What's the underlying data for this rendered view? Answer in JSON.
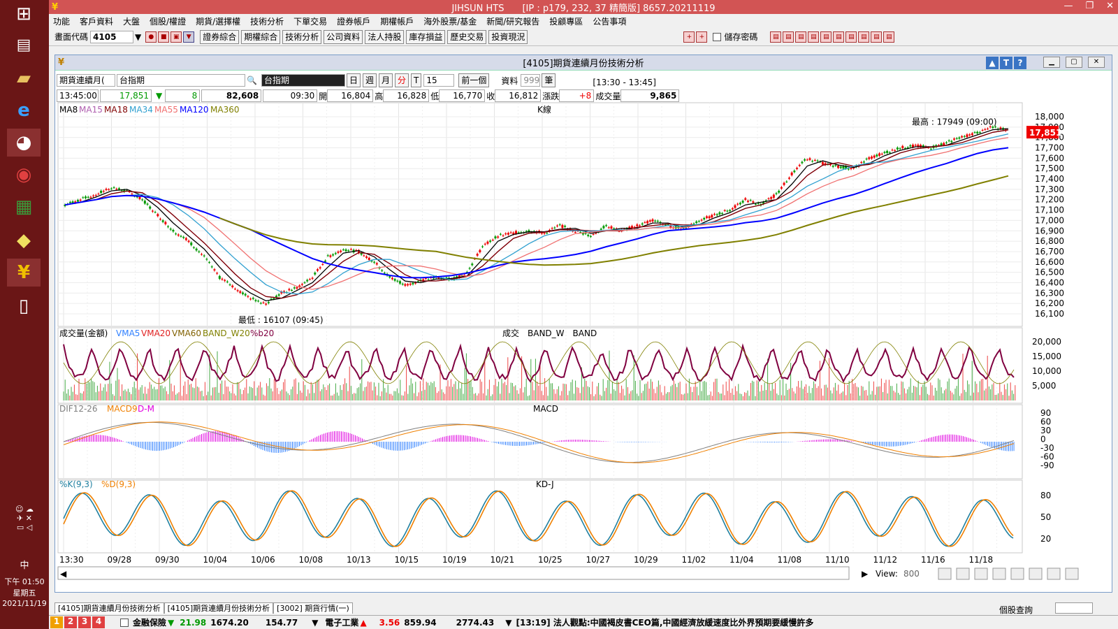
{
  "taskbar": {
    "icons": [
      "windows-icon",
      "window-icon",
      "folder-icon",
      "ie-icon",
      "paint-icon",
      "chrome-icon",
      "excel-icon",
      "sticky-icon",
      "jihsun-icon",
      "file-icon"
    ],
    "time": "下午 01:50",
    "weekday": "星期五",
    "date": "2021/11/19",
    "ime": "中"
  },
  "app": {
    "title": "JIHSUN HTS　　[IP : p179, 232, 37 精簡版] 8657.20211119",
    "menu": [
      "功能",
      "客戶資料",
      "大盤",
      "個股/權證",
      "期貨/選擇權",
      "技術分析",
      "下單交易",
      "證券帳戶",
      "期權帳戶",
      "海外股票/基金",
      "新聞/研究報告",
      "投顧專區",
      "公告事項"
    ],
    "toolbar": {
      "code_label": "畫面代碼",
      "code_value": "4105",
      "buttons": [
        "證券綜合",
        "期權綜合",
        "技術分析",
        "公司資料",
        "法人持股",
        "庫存損益",
        "歷史交易",
        "投資現況"
      ],
      "save_pw": "儲存密碼"
    }
  },
  "window": {
    "title": "[4105]期貨連續月份技術分析"
  },
  "controls": {
    "product_type": "期貨連續月(",
    "product": "台指期",
    "product_display": "台指期",
    "periods": [
      "日",
      "週",
      "月",
      "分",
      "T"
    ],
    "minutes": "15",
    "prev": "前一個",
    "data_label": "資料",
    "data_count": "999",
    "unit": "筆",
    "session": "[13:30 - 13:45]"
  },
  "quote": {
    "time": "13:45:00",
    "price": "17,851",
    "arrow": "▼",
    "change": "8",
    "volume_total": "82,608",
    "open_time": "09:30",
    "open_label": "開",
    "open": "16,804",
    "high_label": "高",
    "high": "16,828",
    "low_label": "低",
    "low": "16,770",
    "close_label": "收",
    "close": "16,812",
    "chg_label": "漲跌",
    "chg": "+8",
    "vol_label": "成交量",
    "vol": "9,865"
  },
  "chart_data": {
    "k": {
      "panel_label": "K線",
      "legend": [
        {
          "name": "MA8",
          "color": "#000000"
        },
        {
          "name": "MA15",
          "color": "#b060b0"
        },
        {
          "name": "MA18",
          "color": "#800000"
        },
        {
          "name": "MA34",
          "color": "#30a0d0"
        },
        {
          "name": "MA55",
          "color": "#f07070"
        },
        {
          "name": "MA120",
          "color": "#0000ff"
        },
        {
          "name": "MA360",
          "color": "#808000"
        }
      ],
      "ylim": [
        16100,
        18000
      ],
      "yticks": [
        "18,000",
        "17,900",
        "17,800",
        "17,700",
        "17,600",
        "17,500",
        "17,400",
        "17,300",
        "17,200",
        "17,100",
        "17,000",
        "16,900",
        "16,800",
        "16,700",
        "16,600",
        "16,500",
        "16,400",
        "16,300",
        "16,200",
        "16,100"
      ],
      "last_price": "17,851",
      "high_note": "最高 : 17949 (09:00)",
      "low_note": "最低 : 16107 (09:45)",
      "price_path": [
        17150,
        17200,
        17250,
        17320,
        17280,
        17200,
        17050,
        16900,
        16800,
        16650,
        16450,
        16350,
        16250,
        16200,
        16300,
        16350,
        16450,
        16650,
        16720,
        16700,
        16600,
        16450,
        16380,
        16420,
        16450,
        16430,
        16500,
        16750,
        16850,
        16880,
        16900,
        16880,
        16950,
        16900,
        16850,
        16950,
        16900,
        16950,
        17000,
        16950,
        16920,
        17000,
        17050,
        17100,
        17200,
        17150,
        17250,
        17450,
        17600,
        17550,
        17520,
        17500,
        17600,
        17650,
        17700,
        17720,
        17700,
        17750,
        17800,
        17850,
        17900,
        17870
      ]
    },
    "volume": {
      "panel_label": "成交　BAND_W　BAND",
      "legend": [
        {
          "name": "成交量(金額)",
          "color": "#000000"
        },
        {
          "name": "VMA5",
          "color": "#3080ff"
        },
        {
          "name": "VMA20",
          "color": "#e02020"
        },
        {
          "name": "VMA60",
          "color": "#806000"
        },
        {
          "name": "BAND_W20",
          "color": "#808000"
        },
        {
          "name": "%b20",
          "color": "#800040"
        }
      ],
      "yticks": [
        "20,000",
        "15,000",
        "10,000",
        "5,000"
      ]
    },
    "macd": {
      "panel_label": "MACD",
      "legend": [
        {
          "name": "DIF12-26",
          "color": "#808080"
        },
        {
          "name": "MACD9",
          "color": "#f08000"
        },
        {
          "name": "D-M",
          "color": "#e000e0"
        }
      ],
      "yticks": [
        "90",
        "60",
        "30",
        "0",
        "-30",
        "-60",
        "-90"
      ]
    },
    "kd": {
      "panel_label": "KD-J",
      "legend": [
        {
          "name": "%K(9,3)",
          "color": "#2080a0"
        },
        {
          "name": "%D(9,3)",
          "color": "#f08000"
        }
      ],
      "yticks": [
        "80",
        "50",
        "20"
      ]
    },
    "xlabels": [
      "13:30",
      "09/28",
      "09/30",
      "10/04",
      "10/06",
      "10/08",
      "10/13",
      "10/15",
      "10/19",
      "10/21",
      "10/25",
      "10/27",
      "10/29",
      "11/02",
      "11/04",
      "11/08",
      "11/10",
      "11/12",
      "11/16",
      "11/18"
    ]
  },
  "bottom": {
    "view_label": "View:",
    "view_value": "800",
    "tabs": [
      "[4105]期貨連續月份技術分析",
      "[4105]期貨連續月份技術分析",
      "[3002] 期貨行情(一)"
    ],
    "stock_query": "個股查詢"
  },
  "statusbar": {
    "nums": [
      "1",
      "2",
      "3",
      "4"
    ],
    "item1": "金融保險",
    "arrow1": "▼",
    "v1": "21.98",
    "v2": "1674.20",
    "v3": "154.77",
    "item2": "電子工業",
    "arrow2": "▲",
    "v4": "3.56",
    "v5": "859.94",
    "v6": "2774.43",
    "news": "[13:19] 法人觀點:中國褐皮書CEO篇,中國經濟放緩速度比外界預期要緩慢許多"
  }
}
